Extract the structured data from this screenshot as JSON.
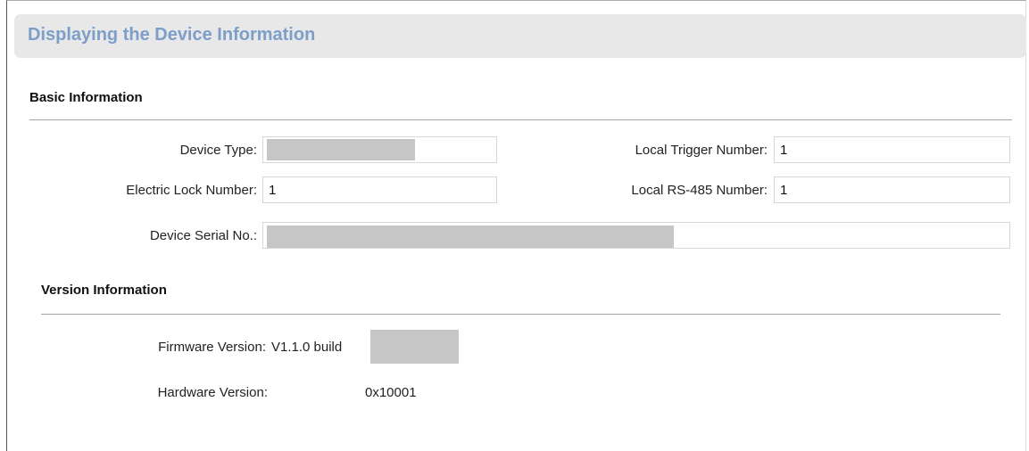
{
  "header": {
    "title": "Displaying the Device Information"
  },
  "basic": {
    "title": "Basic Information",
    "device_type_label": "Device Type:",
    "device_type_value": "",
    "electric_lock_label": "Electric Lock Number:",
    "electric_lock_value": "1",
    "serial_label": "Device Serial No.:",
    "serial_value": "",
    "local_trigger_label": "Local Trigger Number:",
    "local_trigger_value": "1",
    "rs485_label": "Local RS-485 Number:",
    "rs485_value": "1"
  },
  "version": {
    "title": "Version Information",
    "firmware_label": "Firmware Version:",
    "firmware_value": "V1.1.0 build",
    "hardware_label": "Hardware Version:",
    "hardware_value": "0x10001"
  }
}
